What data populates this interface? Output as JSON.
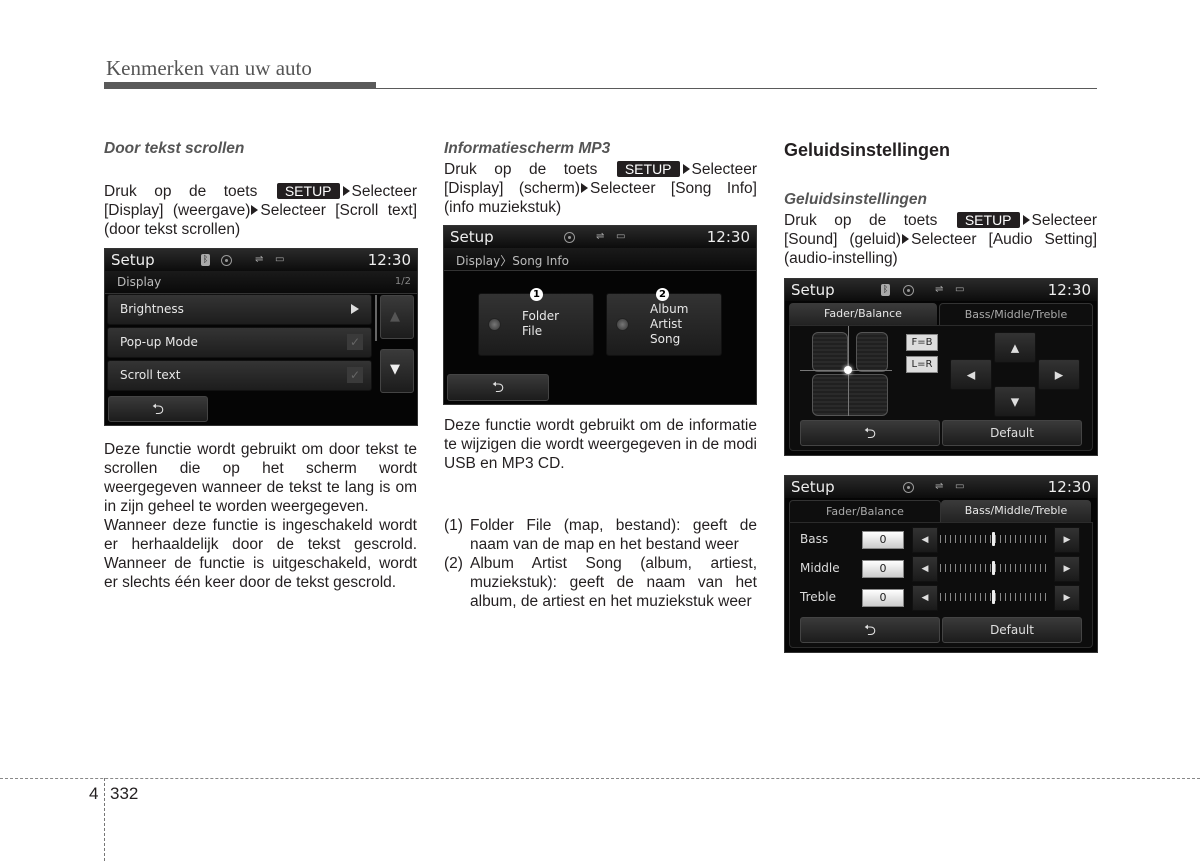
{
  "header": {
    "title": "Kenmerken van uw auto"
  },
  "setup_key": "SETUP",
  "col1": {
    "subtitle": "Door tekst scrollen",
    "instr": {
      "p1": "Druk op de toets",
      "p2": "Selecteer [Display] (weergave)",
      "p3": "Selecteer [Scroll text] (door tekst scrollen)"
    },
    "screen": {
      "title": "Setup",
      "clock": "12:30",
      "section": "Display",
      "page": "1/2",
      "items": [
        {
          "label": "Brightness",
          "control": "arrow"
        },
        {
          "label": "Pop-up Mode",
          "control": "checkbox"
        },
        {
          "label": "Scroll text",
          "control": "checkbox"
        }
      ],
      "back_icon": "⮌",
      "up_icon": "▲",
      "down_icon": "▼"
    },
    "body1": "Deze functie wordt gebruikt om door tekst te scrollen die op het scherm wordt weergegeven wanneer de tekst te lang is om in zijn geheel te worden weergegeven.",
    "body2": "Wanneer deze functie is ingeschakeld wordt er herhaaldelijk door de tekst gescrold. Wanneer de functie is uitgeschakeld, wordt er slechts één keer door de tekst gescrold."
  },
  "col2": {
    "subtitle": "Informatiescherm MP3",
    "instr": {
      "p1": "Druk op de toets",
      "p2": "Selecteer [Display] (scherm)",
      "p3": "Selecteer [Song Info] (info muziekstuk)"
    },
    "screen": {
      "title": "Setup",
      "clock": "12:30",
      "section": "Display〉Song Info",
      "options": [
        {
          "num": "1",
          "lines": [
            "Folder",
            "File"
          ]
        },
        {
          "num": "2",
          "lines": [
            "Album",
            "Artist",
            "Song"
          ]
        }
      ],
      "back_icon": "⮌"
    },
    "body": "Deze functie wordt gebruikt om de informatie te wijzigen die wordt weergegeven in de modi USB en MP3 CD.",
    "list": [
      {
        "num": "(1)",
        "text": "Folder File (map, bestand): geeft de naam van de map en het bestand weer"
      },
      {
        "num": "(2)",
        "text": "Album Artist Song (album, artiest, muziekstuk): geeft de naam van het album, de artiest en het muziekstuk weer"
      }
    ]
  },
  "col3": {
    "title": "Geluidsinstellingen",
    "subtitle": "Geluidsinstellingen",
    "instr": {
      "p1": "Druk op de toets",
      "p2": "Selecteer [Sound] (geluid)",
      "p3": "Selecteer [Audio Setting] (audio-instelling)"
    },
    "screen1": {
      "title": "Setup",
      "clock": "12:30",
      "tabs": [
        "Fader/Balance",
        "Bass/Middle/Treble"
      ],
      "active_tab": 0,
      "tags": [
        "F=B",
        "L=R"
      ],
      "back_icon": "⮌",
      "default_label": "Default"
    },
    "screen2": {
      "title": "Setup",
      "clock": "12:30",
      "tabs": [
        "Fader/Balance",
        "Bass/Middle/Treble"
      ],
      "active_tab": 1,
      "rows": [
        {
          "label": "Bass",
          "value": "0",
          "level": 0.5
        },
        {
          "label": "Middle",
          "value": "0",
          "level": 0.5
        },
        {
          "label": "Treble",
          "value": "0",
          "level": 0.5
        }
      ],
      "back_icon": "⮌",
      "default_label": "Default"
    }
  },
  "footer": {
    "chapter": "4",
    "page": "332"
  }
}
